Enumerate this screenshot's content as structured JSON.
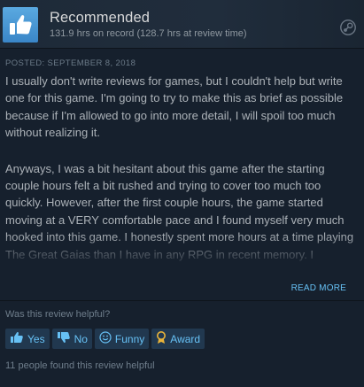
{
  "review": {
    "verdict": "Recommended",
    "hours": "131.9 hrs on record (128.7 hrs at review time)",
    "posted": "POSTED: SEPTEMBER 8, 2018",
    "paragraphs": [
      "I usually don't write reviews for games, but I couldn't help but write one for this game. I'm going to try to make this as brief as possible because if I'm allowed to go into more detail, I will spoil too much without realizing it.",
      "Anyways, I was a bit hesitant about this game after the starting couple hours felt a bit rushed and trying to cover too much too quickly. However, after the first couple hours, the game started moving at a VERY comfortable pace and I found myself very much hooked into this game. I honestly spent more hours at a time playing The Great Gaias than I have in any RPG in recent memory. I absolutely found myself hooked on the game's story and wanting to see how everything played out."
    ],
    "read_more": "READ MORE"
  },
  "helpful": {
    "question": "Was this review helpful?",
    "yes": "Yes",
    "no": "No",
    "funny": "Funny",
    "award": "Award",
    "found_count": "11 people found this review helpful"
  },
  "icons": {
    "verdict": "thumbs-up-icon",
    "platform": "steam-icon",
    "yes": "thumbs-up-icon",
    "no": "thumbs-down-icon",
    "funny": "smiley-icon",
    "award": "award-icon"
  },
  "colors": {
    "background": "#16202d",
    "header": "#1e2a38",
    "thumb_box": "#4a97d6",
    "link": "#66c0f4",
    "button": "#21384f",
    "award_gold": "#e8b33a"
  }
}
